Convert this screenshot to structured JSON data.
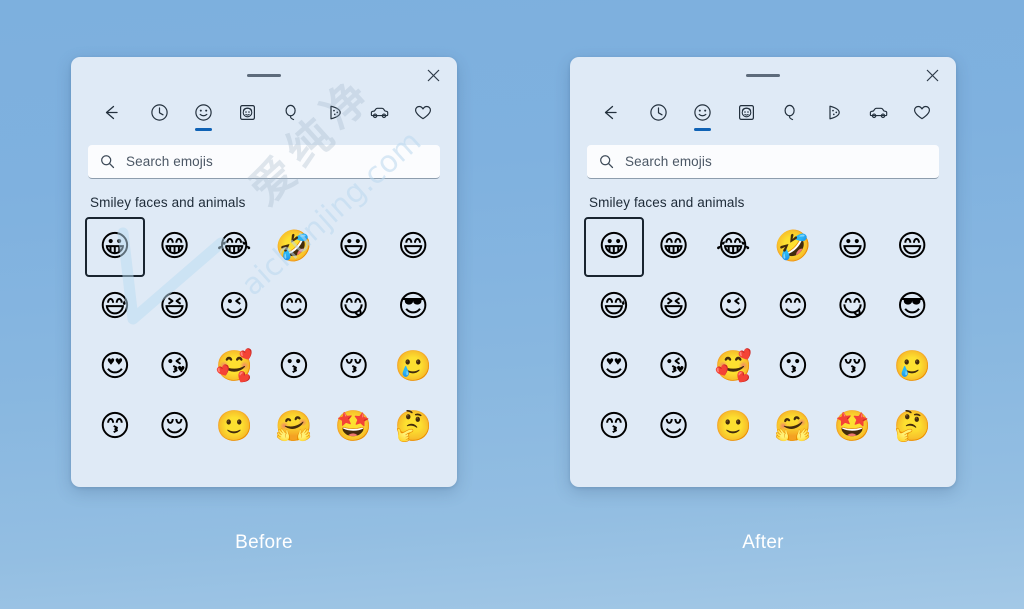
{
  "background": {
    "gradient_top": "#7db0de",
    "gradient_bottom": "#a3c8e6"
  },
  "accent_color": "#0f62b5",
  "panel_bg": "#dfeaf6",
  "comparison": {
    "before_label": "Before",
    "after_label": "After"
  },
  "watermark": {
    "text": "aichunjing.com",
    "cjk_text": "爱纯净",
    "color": "#cfe1f1"
  },
  "panel": {
    "close_label": "✕",
    "drag_handle_name": "drag-handle",
    "tabs": [
      {
        "name": "back-button",
        "icon": "back-arrow-icon",
        "active": false
      },
      {
        "name": "tab-recent",
        "icon": "clock-icon",
        "active": false
      },
      {
        "name": "tab-smileys",
        "icon": "smiley-icon",
        "active": true
      },
      {
        "name": "tab-people",
        "icon": "person-icon",
        "active": false
      },
      {
        "name": "tab-celebration",
        "icon": "balloon-icon",
        "active": false
      },
      {
        "name": "tab-food",
        "icon": "pizza-icon",
        "active": false
      },
      {
        "name": "tab-travel",
        "icon": "car-icon",
        "active": false
      },
      {
        "name": "tab-symbols",
        "icon": "heart-icon",
        "active": false
      }
    ],
    "search": {
      "placeholder": "Search emojis",
      "value": "",
      "icon": "search-icon"
    },
    "section_title": "Smiley faces and animals",
    "emoji_rows": [
      [
        {
          "name": "emoji-grinning-face",
          "char": "😀",
          "selected": true
        },
        {
          "name": "emoji-beaming-face",
          "char": "😁",
          "selected": false
        },
        {
          "name": "emoji-face-with-tears-of-joy",
          "char": "😂",
          "selected": false
        },
        {
          "name": "emoji-rolling-on-floor-laughing",
          "char": "🤣",
          "selected": false
        },
        {
          "name": "emoji-grinning-big-eyes",
          "char": "😃",
          "selected": false
        },
        {
          "name": "emoji-grinning-smiling-eyes",
          "char": "😄",
          "selected": false
        }
      ],
      [
        {
          "name": "emoji-grinning-sweat",
          "char": "😅",
          "selected": false
        },
        {
          "name": "emoji-squinting-face",
          "char": "😆",
          "selected": false
        },
        {
          "name": "emoji-winking-face",
          "char": "😉",
          "selected": false
        },
        {
          "name": "emoji-smiling-face",
          "char": "😊",
          "selected": false
        },
        {
          "name": "emoji-face-savoring-food",
          "char": "😋",
          "selected": false
        },
        {
          "name": "emoji-smiling-with-sunglasses",
          "char": "😎",
          "selected": false
        }
      ],
      [
        {
          "name": "emoji-heart-eyes",
          "char": "😍",
          "selected": false
        },
        {
          "name": "emoji-blowing-a-kiss",
          "char": "😘",
          "selected": false
        },
        {
          "name": "emoji-smiling-with-hearts",
          "char": "🥰",
          "selected": false
        },
        {
          "name": "emoji-kissing-face",
          "char": "😗",
          "selected": false
        },
        {
          "name": "emoji-kissing-closed-eyes",
          "char": "😚",
          "selected": false
        },
        {
          "name": "emoji-kissing-with-tear",
          "char": "🥲",
          "selected": false
        }
      ],
      [
        {
          "name": "emoji-kissing-smiling-eyes",
          "char": "😙",
          "selected": false
        },
        {
          "name": "emoji-relieved-face",
          "char": "😌",
          "selected": false
        },
        {
          "name": "emoji-slightly-smiling-face",
          "char": "🙂",
          "selected": false
        },
        {
          "name": "emoji-hugging-face",
          "char": "🤗",
          "selected": false
        },
        {
          "name": "emoji-star-struck",
          "char": "🤩",
          "selected": false
        },
        {
          "name": "emoji-thinking-face",
          "char": "🤔",
          "selected": false
        }
      ]
    ]
  }
}
